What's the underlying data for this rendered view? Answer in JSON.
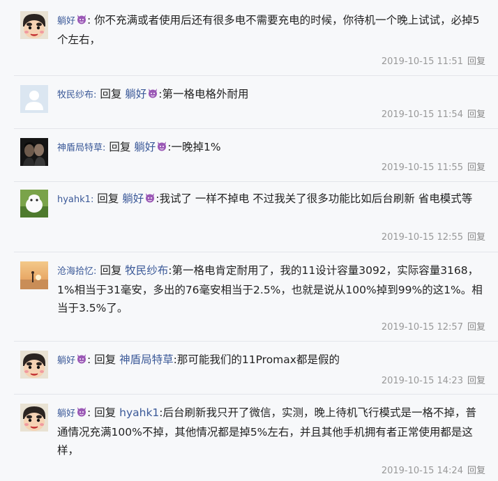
{
  "comments": [
    {
      "user": "躺好",
      "user_has_devil": true,
      "reply_word": "",
      "target": "",
      "target_has_devil": false,
      "text": ": 你不充满或者使用后还有很多电不需要充电的时候，你待机一个晚上试试，必掉5个左右，",
      "time": "2019-10-15 11:51",
      "reply_label": "回复",
      "avatar": "crayon-shinchan"
    },
    {
      "user": "牧民纱布:",
      "user_has_devil": false,
      "reply_word": "回复",
      "target": "躺好",
      "target_has_devil": true,
      "text": ":第一格电格外耐用",
      "time": "2019-10-15 11:54",
      "reply_label": "回复",
      "avatar": "default-person"
    },
    {
      "user": "神盾局特草:",
      "user_has_devil": false,
      "reply_word": "回复",
      "target": "躺好",
      "target_has_devil": true,
      "text": ":一晚掉1%",
      "time": "2019-10-15 11:55",
      "reply_label": "回复",
      "avatar": "dark-couple"
    },
    {
      "user": "hyahk1:",
      "user_has_devil": false,
      "reply_word": "回复",
      "target": "躺好",
      "target_has_devil": true,
      "text": ":我试了 一样不掉电 不过我关了很多功能比如后台刷新 省电模式等",
      "time": "2019-10-15 12:55",
      "reply_label": "回复",
      "avatar": "white-blob"
    },
    {
      "user": "沧海拾忆:",
      "user_has_devil": false,
      "reply_word": "回复",
      "target": "牧民纱布",
      "target_has_devil": false,
      "text": ":第一格电肯定耐用了，我的11设计容量3092，实际容量3168，1%相当于31毫安，多出的76毫安相当于2.5%，也就是说从100%掉到99%的这1%。相当于3.5%了。",
      "time": "2019-10-15 12:57",
      "reply_label": "回复",
      "avatar": "beach-sunset"
    },
    {
      "user": "躺好",
      "user_has_devil": true,
      "reply_word": "回复",
      "target": "神盾局特草",
      "target_has_devil": false,
      "text": ":那可能我们的11Promax都是假的",
      "time": "2019-10-15 14:23",
      "reply_label": "回复",
      "avatar": "crayon-shinchan"
    },
    {
      "user": "躺好",
      "user_has_devil": true,
      "reply_word": "回复",
      "target": "hyahk1",
      "target_has_devil": false,
      "text": ":后台刷新我只开了微信，实测，晚上待机飞行模式是一格不掉，普通情况充满100%不掉，其他情况都是掉5%左右，并且其他手机拥有者正常使用都是这样，",
      "time": "2019-10-15 14:24",
      "reply_label": "回复",
      "avatar": "crayon-shinchan"
    }
  ]
}
